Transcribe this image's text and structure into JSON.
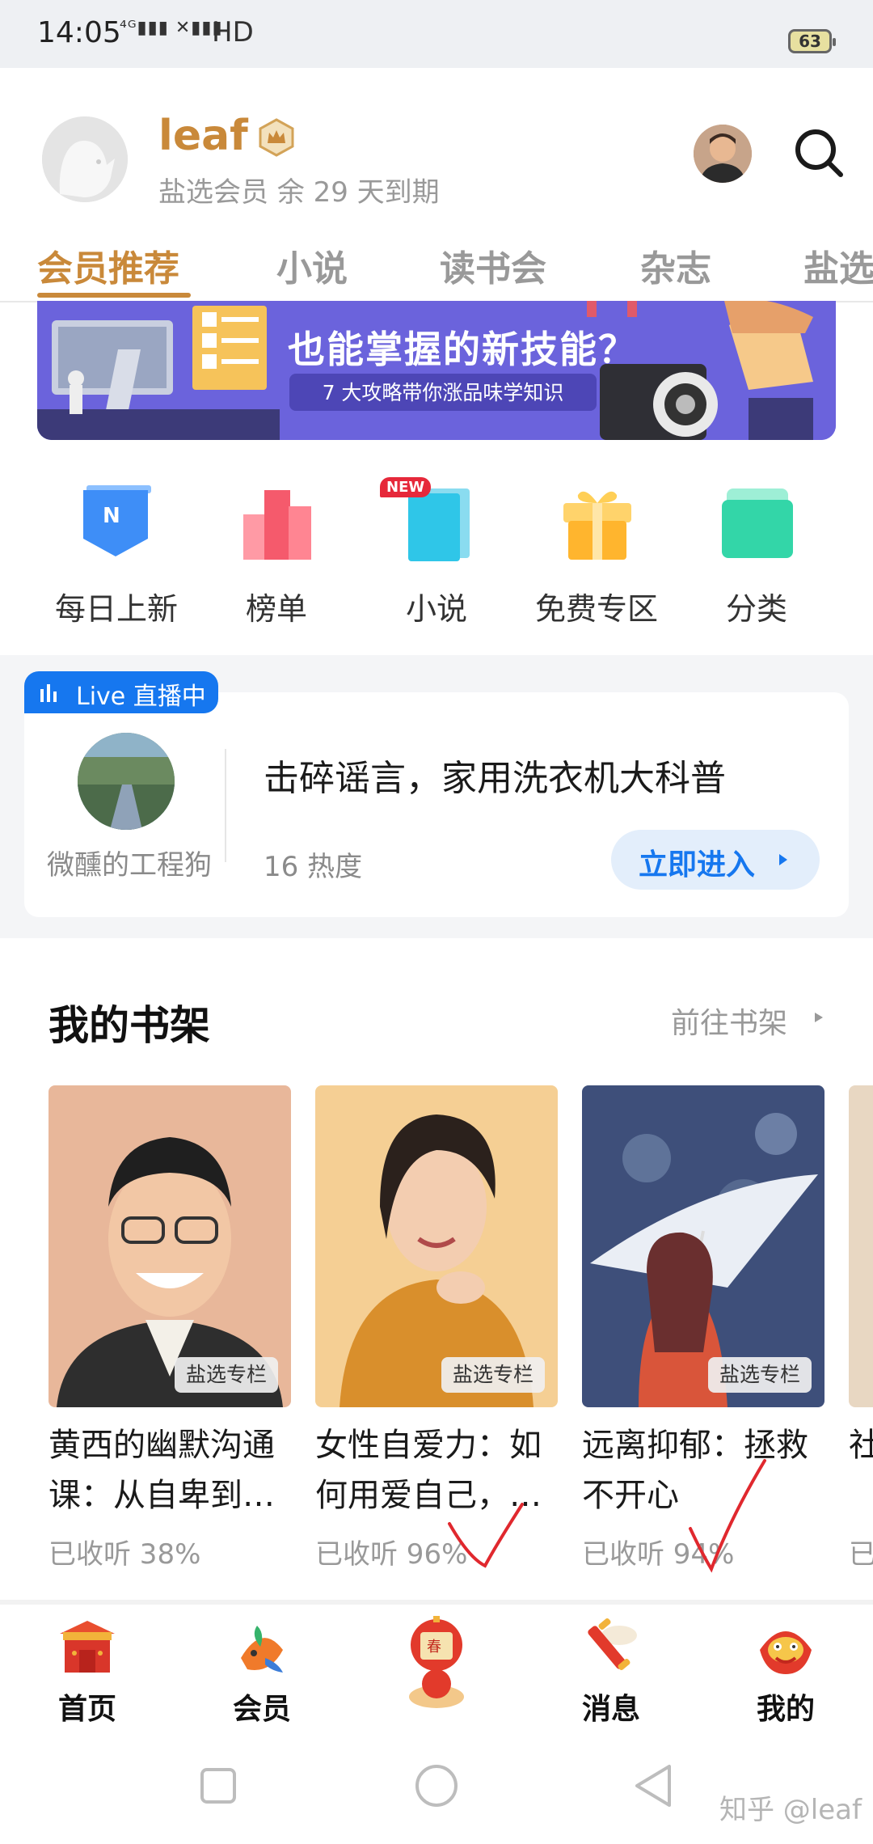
{
  "status_bar": {
    "time": "14:05",
    "network": "⁴ᴳ▮▮▮ ✕▮▮▮",
    "hd": "HD",
    "battery": "63"
  },
  "profile": {
    "username": "leaf",
    "member_status": "盐选会员 余 29 天到期"
  },
  "tabs": [
    {
      "label": "会员推荐",
      "active": true
    },
    {
      "label": "小说",
      "active": false
    },
    {
      "label": "读书会",
      "active": false
    },
    {
      "label": "杂志",
      "active": false
    },
    {
      "label": "盐选",
      "active": false
    }
  ],
  "banner": {
    "headline": "也能掌握的新技能？",
    "subline": "7 大攻略带你涨品味学知识"
  },
  "quick_nav": [
    {
      "label": "每日上新",
      "icon": "daily-new-icon",
      "color": "#3e8ef7"
    },
    {
      "label": "榜单",
      "icon": "ranking-icon",
      "color": "#f55a6c"
    },
    {
      "label": "小说",
      "icon": "novel-icon",
      "color": "#2fc6e8",
      "badge": "NEW"
    },
    {
      "label": "免费专区",
      "icon": "gift-icon",
      "color": "#ffb52e"
    },
    {
      "label": "分类",
      "icon": "category-icon",
      "color": "#33d6a8"
    }
  ],
  "live": {
    "badge": "Live 直播中",
    "host_name": "微醺的工程狗",
    "title": "击碎谣言，家用洗衣机大科普",
    "heat": "16 热度",
    "enter_label": "立即进入"
  },
  "bookshelf": {
    "title": "我的书架",
    "link": "前往书架",
    "books": [
      {
        "title": "黄西的幽默沟通课：从自卑到…",
        "tag": "盐选专栏",
        "progress": "已收听 38%",
        "cover_color": "#e8b79a"
      },
      {
        "title": "女性自爱力：如何用爱自己，…",
        "tag": "盐选专栏",
        "progress": "已收听 96%",
        "cover_color": "#f2c58a"
      },
      {
        "title": "远离抑郁：拯救不开心",
        "tag": "盐选专栏",
        "progress": "已收听 94%",
        "cover_color": "#3e4f7a"
      },
      {
        "title": "社",
        "tag": "",
        "progress": "已",
        "cover_color": "#e8d7c2"
      }
    ]
  },
  "bottom_nav": [
    {
      "label": "首页",
      "icon": "home-icon"
    },
    {
      "label": "会员",
      "icon": "member-icon"
    },
    {
      "label": "",
      "icon": "festival-icon"
    },
    {
      "label": "消息",
      "icon": "message-icon"
    },
    {
      "label": "我的",
      "icon": "mine-icon"
    }
  ],
  "watermark": "知乎 @leaf"
}
